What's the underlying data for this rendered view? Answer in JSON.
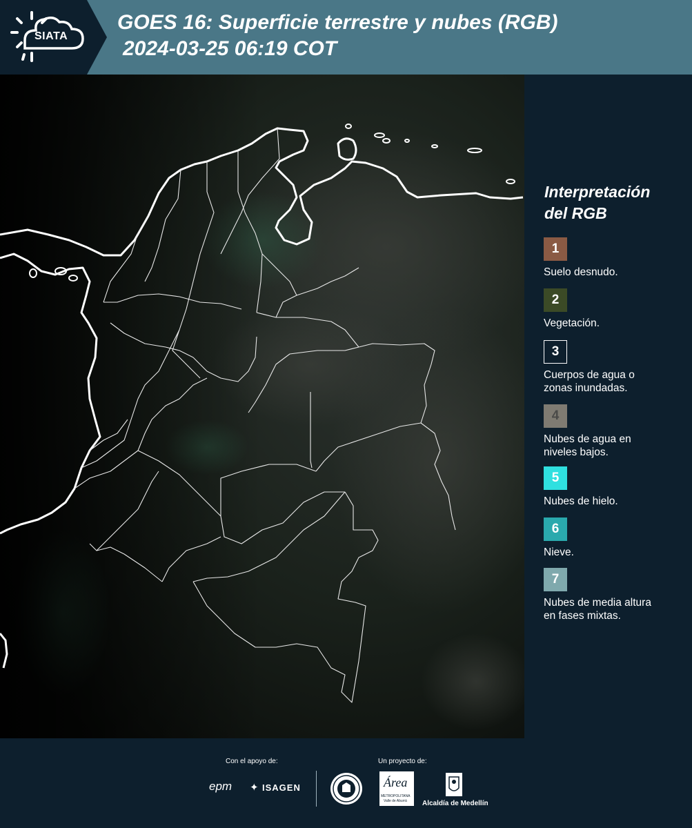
{
  "header": {
    "logo_text": "SIATA",
    "title_line1": "GOES 16: Superficie terrestre y nubes (RGB)",
    "title_line2": "2024-03-25 06:19 COT"
  },
  "legend": {
    "title_line1": "Interpretación",
    "title_line2": "del RGB",
    "items": [
      {
        "number": "1",
        "label_line1": "Suelo desnudo.",
        "label_line2": "",
        "color": "#8a5a44",
        "number_color": "#ffffff"
      },
      {
        "number": "2",
        "label_line1": "Vegetación.",
        "label_line2": "",
        "color": "#3b4a26",
        "number_color": "#ffffff"
      },
      {
        "number": "3",
        "label_line1": "Cuerpos de agua o",
        "label_line2": "zonas inundadas.",
        "color": "#0d1f2d",
        "number_color": "#ffffff"
      },
      {
        "number": "4",
        "label_line1": "Nubes de agua en",
        "label_line2": "niveles bajos.",
        "color": "#7f7b72",
        "number_color": "#4a4a48"
      },
      {
        "number": "5",
        "label_line1": "Nubes de hielo.",
        "label_line2": "",
        "color": "#2fe0e0",
        "number_color": "#ffffff"
      },
      {
        "number": "6",
        "label_line1": "Nieve.",
        "label_line2": "",
        "color": "#2aa9ad",
        "number_color": "#ffffff"
      },
      {
        "number": "7",
        "label_line1": "Nubes de media altura",
        "label_line2": "en fases mixtas.",
        "color": "#7fa9ad",
        "number_color": "#ffffff"
      }
    ]
  },
  "footer": {
    "support_label": "Con el apoyo de:",
    "project_label": "Un proyecto de:",
    "sponsor1": "epm",
    "sponsor2": "ISAGEN",
    "partner1_text": "Área",
    "partner1_sub1": "METROPOLITANA",
    "partner1_sub2": "Valle de Aburrá",
    "partner2": "Alcaldía de Medellín"
  }
}
